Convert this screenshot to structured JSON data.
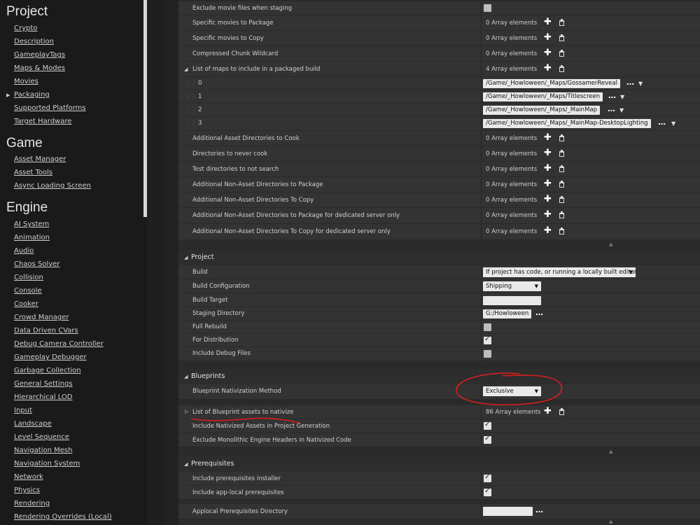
{
  "sidebar": {
    "sections": [
      {
        "title": "Project",
        "items": [
          "Crypto",
          "Description",
          "GameplayTags",
          "Maps & Modes",
          "Movies",
          "Packaging",
          "Supported Platforms",
          "Target Hardware"
        ],
        "active": "Packaging"
      },
      {
        "title": "Game",
        "items": [
          "Asset Manager",
          "Asset Tools",
          "Async Loading Screen"
        ]
      },
      {
        "title": "Engine",
        "items": [
          "AI System",
          "Animation",
          "Audio",
          "Chaos Solver",
          "Collision",
          "Console",
          "Cooker",
          "Crowd Manager",
          "Data Driven CVars",
          "Debug Camera Controller",
          "Gameplay Debugger",
          "Garbage Collection",
          "General Settings",
          "Hierarchical LOD",
          "Input",
          "Landscape",
          "Level Sequence",
          "Navigation Mesh",
          "Navigation System",
          "Network",
          "Physics",
          "Rendering",
          "Rendering Overrides (Local)"
        ]
      }
    ]
  },
  "packaging": {
    "exclude_movies": "Exclude movie files when staging",
    "specific_movies_package": "Specific movies to Package",
    "specific_movies_copy": "Specific movies to Copy",
    "compressed_chunk": "Compressed Chunk Wildcard",
    "maps_list": "List of maps to include in a packaged build",
    "zero_elements": "0 Array elements",
    "four_elements": "4 Array elements",
    "maps": [
      {
        "index": "0",
        "path": "/Game/_Howloween/_Maps/GossamerReveal"
      },
      {
        "index": "1",
        "path": "/Game/_Howloween/_Maps/Titlescreen"
      },
      {
        "index": "2",
        "path": "/Game/_Howloween/_Maps/_MainMap"
      },
      {
        "index": "3",
        "path": "/Game/_Howloween/_Maps/_MainMap-DesktopLighting"
      }
    ],
    "array_rows": [
      "Additional Asset Directories to Cook",
      "Directories to never cook",
      "Test directories to not search",
      "Additional Non-Asset Directories to Package",
      "Additional Non-Asset Directories To Copy",
      "Additional Non-Asset Directories to Package for dedicated server only",
      "Additional Non-Asset Directories To Copy for dedicated server only"
    ]
  },
  "project": {
    "title": "Project",
    "build_label": "Build",
    "build_value": "If project has code, or running a locally built editor",
    "build_config_label": "Build Configuration",
    "build_config_value": "Shipping",
    "build_target_label": "Build Target",
    "staging_dir_label": "Staging Directory",
    "staging_dir_value": "G:/Howloween",
    "full_rebuild_label": "Full Rebuild",
    "full_rebuild": false,
    "for_distribution_label": "For Distribution",
    "for_distribution": true,
    "include_debug_label": "Include Debug Files",
    "include_debug": false
  },
  "blueprints": {
    "title": "Blueprints",
    "nativization_label": "Blueprint Nativization Method",
    "nativization_value": "Exclusive",
    "assets_label": "List of Blueprint assets to nativize",
    "assets_count": "86 Array elements",
    "include_nativized_label": "Include Nativized Assets in Project Generation",
    "include_nativized": true,
    "exclude_monolithic_label": "Exclude Monolithic Engine Headers in Nativized Code",
    "exclude_monolithic": true
  },
  "prerequisites": {
    "title": "Prerequisites",
    "installer_label": "Include prerequisites installer",
    "installer": true,
    "applocal_label": "Include app-local prerequisites",
    "applocal": true,
    "applocal_dir_label": "Applocal Prerequisites Directory"
  },
  "icons": {
    "add": "plus-icon",
    "delete": "trash-icon",
    "browse": "ellipsis-icon",
    "dropdown": "caret-down-icon"
  },
  "colors": {
    "annotation": "#d81e1e",
    "panel": "#333333",
    "sidebar": "#1a1a1a"
  }
}
